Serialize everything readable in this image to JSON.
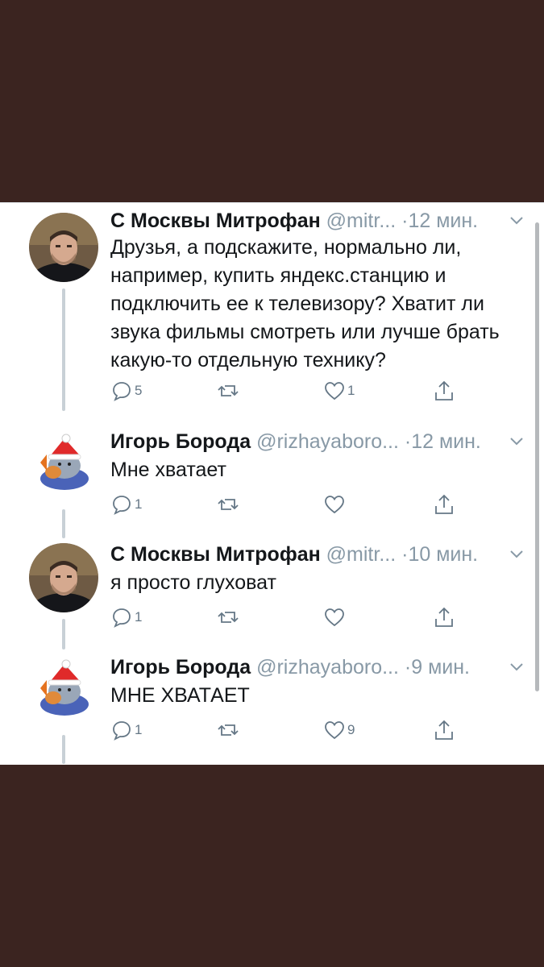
{
  "tweets": [
    {
      "name": "С Москвы Митрофан",
      "handle": "@mitr...",
      "time": "12 мин.",
      "text": "Друзья, а подскажите, нормально ли, например, купить яндекс.станцию и подключить ее к телевизору? Хватит ли звука фильмы смотреть или лучше брать какую-то отдельную технику?",
      "replies": "5",
      "retweets": "",
      "likes": "1",
      "avatar": "man-photo"
    },
    {
      "name": "Игорь Борода",
      "handle": "@rizhayaboro...",
      "time": "12 мин.",
      "text": "Мне хватает",
      "replies": "1",
      "retweets": "",
      "likes": "",
      "avatar": "cartoon-santa-mouse"
    },
    {
      "name": "С Москвы Митрофан",
      "handle": "@mitr...",
      "time": "10 мин.",
      "text": "я просто глуховат",
      "replies": "1",
      "retweets": "",
      "likes": "",
      "avatar": "man-photo"
    },
    {
      "name": "Игорь Борода",
      "handle": "@rizhayaboro...",
      "time": "9 мин.",
      "text": "МНЕ ХВАТАЕТ",
      "replies": "1",
      "retweets": "",
      "likes": "9",
      "avatar": "cartoon-santa-mouse"
    }
  ],
  "colors": {
    "background": "#3b2420",
    "panel": "#ffffff",
    "name": "#14171a",
    "muted": "#8899a6",
    "icon": "#657786",
    "thread_line": "#c8d0d6"
  },
  "icons": [
    "reply-icon",
    "retweet-icon",
    "like-icon",
    "share-icon",
    "chevron-down-icon"
  ]
}
